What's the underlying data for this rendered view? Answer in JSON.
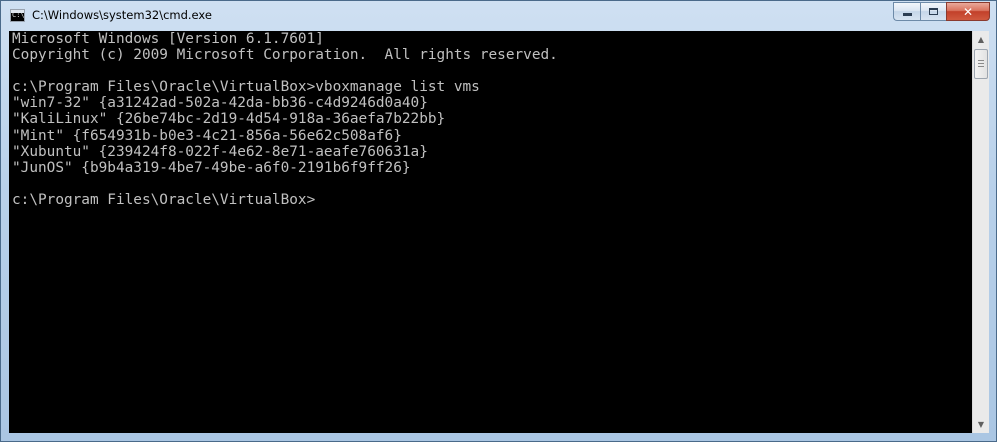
{
  "window": {
    "title": "C:\\Windows\\system32\\cmd.exe",
    "icon": "cmd-icon",
    "icon_text": "C:\\"
  },
  "caption": {
    "minimize": "minimize-icon",
    "maximize": "maximize-icon",
    "close": "✕"
  },
  "console": {
    "lines": [
      "Microsoft Windows [Version 6.1.7601]",
      "Copyright (c) 2009 Microsoft Corporation.  All rights reserved.",
      "",
      "c:\\Program Files\\Oracle\\VirtualBox>vboxmanage list vms",
      "\"win7-32\" {a31242ad-502a-42da-bb36-c4d9246d0a40}",
      "\"KaliLinux\" {26be74bc-2d19-4d54-918a-36aefa7b22bb}",
      "\"Mint\" {f654931b-b0e3-4c21-856a-56e62c508af6}",
      "\"Xubuntu\" {239424f8-022f-4e62-8e71-aeafe760631a}",
      "\"JunOS\" {b9b4a319-4be7-49be-a6f0-2191b6f9ff26}",
      "",
      "c:\\Program Files\\Oracle\\VirtualBox>"
    ]
  },
  "scrollbar": {
    "up_arrow": "▲",
    "down_arrow": "▼"
  },
  "colors": {
    "console_bg": "#000000",
    "console_fg": "#c0c0c0",
    "close_button": "#c2402a"
  }
}
